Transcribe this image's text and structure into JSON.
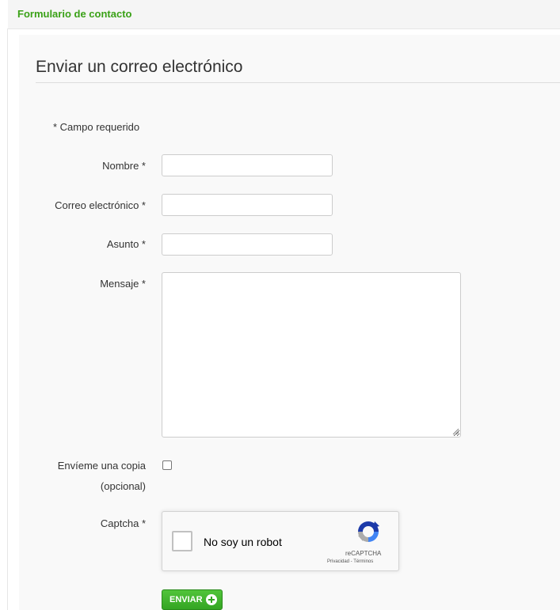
{
  "header": {
    "title": "Formulario de contacto"
  },
  "form": {
    "section_title": "Enviar un correo electrónico",
    "required_note": "* Campo requerido",
    "fields": {
      "name": {
        "label": "Nombre *",
        "value": "",
        "placeholder": ""
      },
      "email": {
        "label": "Correo electrónico *",
        "value": "",
        "placeholder": ""
      },
      "subject": {
        "label": "Asunto *",
        "value": "",
        "placeholder": ""
      },
      "message": {
        "label": "Mensaje *",
        "value": "",
        "placeholder": ""
      }
    },
    "copy": {
      "label_line1": "Envíeme una copia",
      "label_line2": "(opcional)",
      "checked": false
    },
    "captcha": {
      "label": "Captcha *",
      "checkbox_text": "No soy un robot",
      "brand": "reCAPTCHA",
      "links": "Privacidad - Términos",
      "icon": "recaptcha-logo-icon"
    },
    "submit": {
      "label": "ENVIAR",
      "icon": "plus-circle-icon"
    }
  },
  "colors": {
    "accent_green": "#3aa117",
    "button_green": "#34a523",
    "panel_background": "#f9f9f9"
  }
}
